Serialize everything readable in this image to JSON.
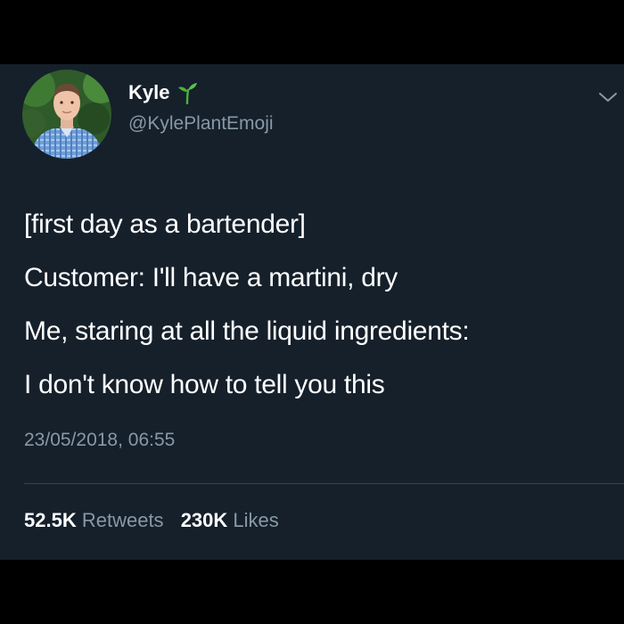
{
  "author": {
    "name": "Kyle",
    "handle": "@KylePlantEmoji",
    "name_emoji": "seedling-icon",
    "avatar": "profile-photo"
  },
  "tweet": {
    "lines": [
      "[first day as a bartender]",
      "Customer: I'll have a martini, dry",
      "Me, staring at all the liquid ingredients:",
      "I don't know how to tell you this"
    ],
    "timestamp": "23/05/2018, 06:55"
  },
  "stats": {
    "retweets_count": "52.5K",
    "retweets_label": "Retweets",
    "likes_count": "230K",
    "likes_label": "Likes"
  },
  "icons": {
    "menu": "chevron-down-icon"
  },
  "colors": {
    "background": "#15202b",
    "letterbox": "#000000",
    "text_primary": "#ffffff",
    "text_secondary": "#8899a6",
    "divider": "#38444d",
    "sprout": "#4caf3f"
  }
}
